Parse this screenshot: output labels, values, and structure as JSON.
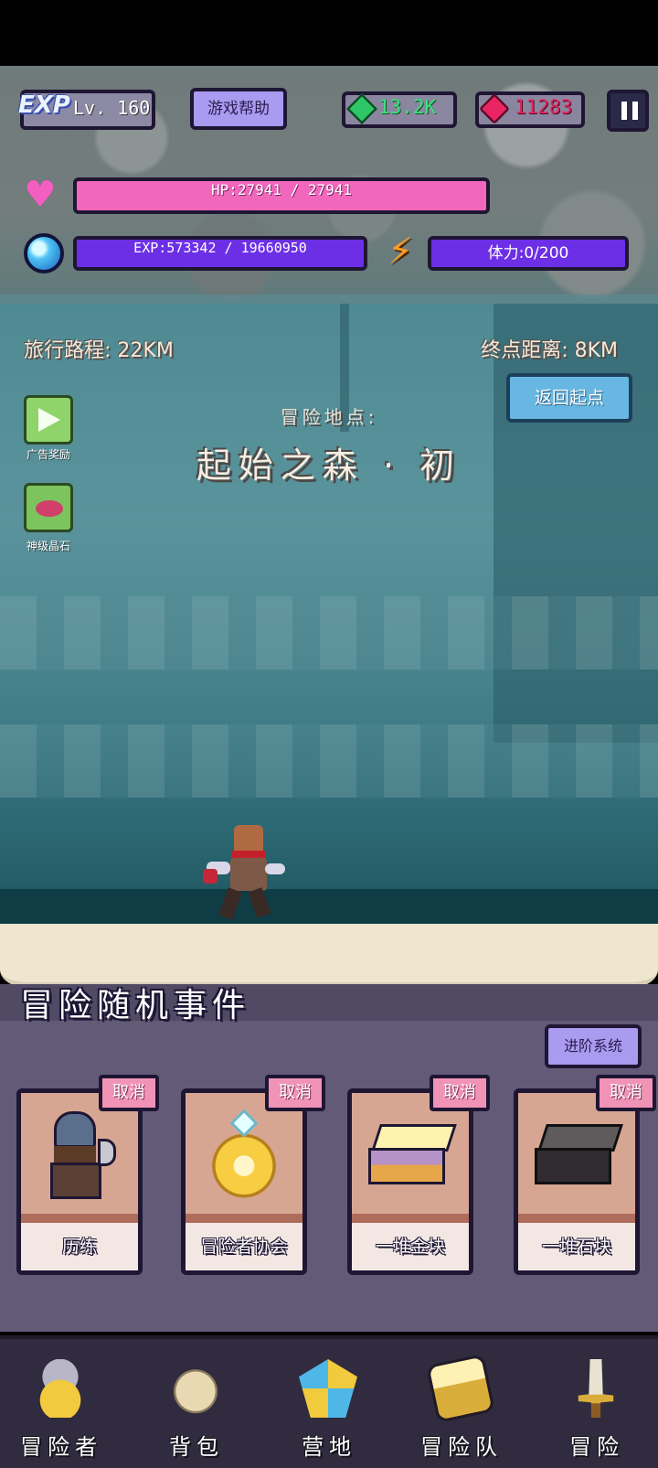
{
  "hud": {
    "exp_tag": "EXP",
    "level": "Lv. 160",
    "help_button": "游戏帮助",
    "gems": "13.2K",
    "rubies": "11283",
    "hp": "HP:27941 / 27941",
    "exp": "EXP:573342 / 19660950",
    "stamina": "体力:0/200"
  },
  "travel": {
    "distance": "旅行路程: 22KM",
    "remaining": "终点距离: 8KM",
    "return_button": "返回起点"
  },
  "side_buttons": {
    "ad_reward": "广告奖励",
    "divine_crystal": "神级晶石"
  },
  "location": {
    "title": "冒险地点:",
    "name": "起始之森 · 初"
  },
  "events": {
    "title": "冒险随机事件",
    "advance_button": "进阶系统",
    "cancel_label": "取消",
    "cards": [
      {
        "label": "历练",
        "icon": "knight-icon"
      },
      {
        "label": "冒险者协会",
        "icon": "guild-emblem-icon"
      },
      {
        "label": "一堆金块",
        "icon": "gold-block-icon"
      },
      {
        "label": "一堆石块",
        "icon": "stone-block-icon"
      }
    ]
  },
  "nav": [
    {
      "label": "冒险者",
      "icon": "crown-icon"
    },
    {
      "label": "背包",
      "icon": "backpack-icon"
    },
    {
      "label": "营地",
      "icon": "camp-icon"
    },
    {
      "label": "冒险队",
      "icon": "team-icon"
    },
    {
      "label": "冒险",
      "icon": "sword-icon"
    }
  ],
  "colors": {
    "hp_bar": "#f067bc",
    "exp_bar": "#6c2fe6",
    "gem": "#3de27e",
    "ruby": "#e3245f",
    "button_purple": "#a99bef",
    "button_blue": "#68b7e2",
    "cancel_pink": "#f193b6"
  }
}
